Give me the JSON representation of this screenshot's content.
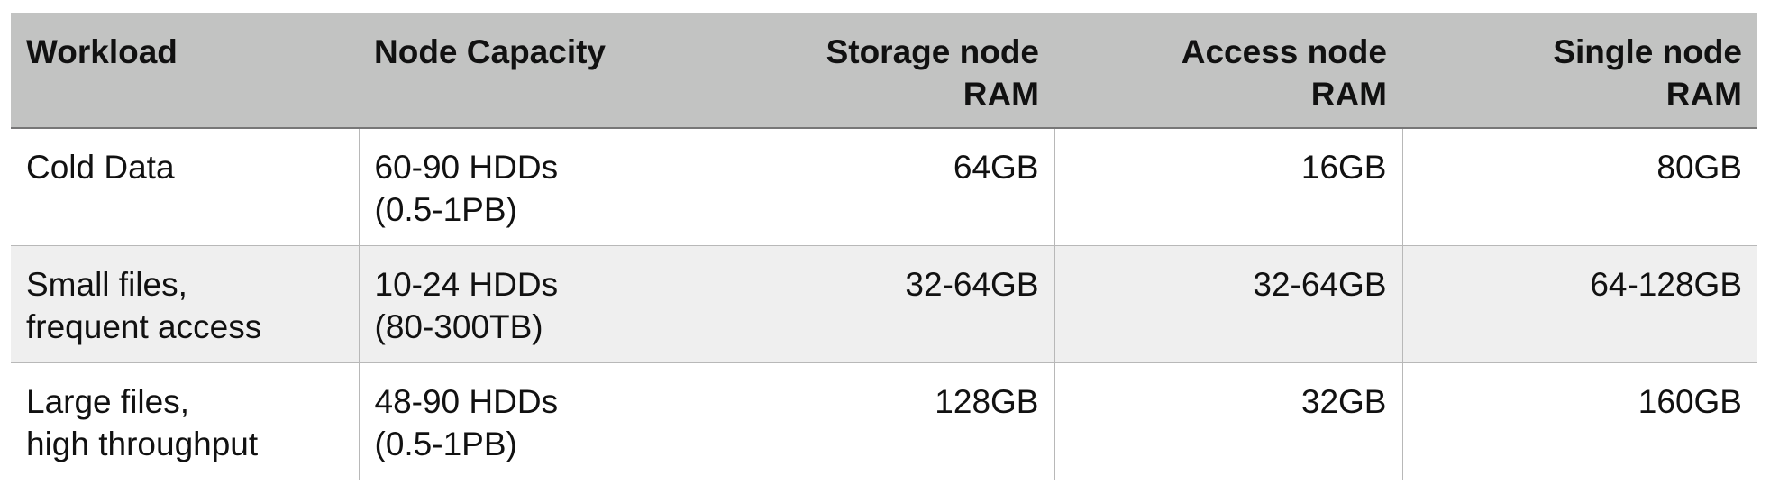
{
  "table": {
    "headers": [
      "Workload",
      "Node Capacity",
      "Storage node\nRAM",
      "Access node\nRAM",
      "Single node\nRAM"
    ],
    "rows": [
      [
        "Cold Data",
        "60-90 HDDs\n(0.5-1PB)",
        "64GB",
        "16GB",
        "80GB"
      ],
      [
        "Small files,\nfrequent access",
        "10-24 HDDs\n(80-300TB)",
        "32-64GB",
        "32-64GB",
        "64-128GB"
      ],
      [
        "Large files,\nhigh throughput",
        "48-90 HDDs\n(0.5-1PB)",
        "128GB",
        "32GB",
        "160GB"
      ]
    ]
  },
  "colors": {
    "header_background": "#c2c3c2",
    "shaded_row_background": "#efefef",
    "border": "#b8b8b8"
  }
}
